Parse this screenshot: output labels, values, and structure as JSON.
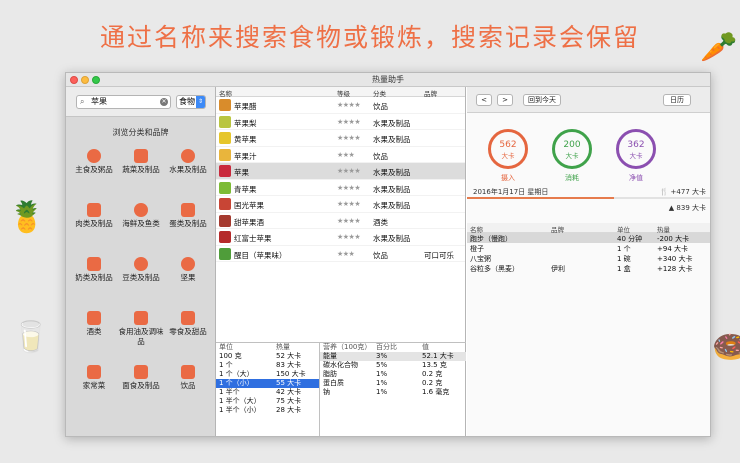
{
  "promo": {
    "headline": "通过名称来搜索食物或锻炼，搜索记录会保留"
  },
  "window": {
    "title": "热量助手"
  },
  "search": {
    "value": "苹果",
    "category": "食物"
  },
  "browse": {
    "title": "浏览分类和品牌"
  },
  "categories": [
    {
      "label": "主食及粥品",
      "icon": "bowl-icon"
    },
    {
      "label": "蔬菜及制品",
      "icon": "carrot-icon"
    },
    {
      "label": "水果及制品",
      "icon": "strawberry-icon"
    },
    {
      "label": "肉类及制品",
      "icon": "meat-icon"
    },
    {
      "label": "海鲜及鱼类",
      "icon": "fish-icon"
    },
    {
      "label": "蛋类及制品",
      "icon": "egg-icon"
    },
    {
      "label": "奶类及制品",
      "icon": "milk-icon"
    },
    {
      "label": "豆类及制品",
      "icon": "bean-icon"
    },
    {
      "label": "坚果",
      "icon": "nut-icon"
    },
    {
      "label": "酒类",
      "icon": "beer-icon"
    },
    {
      "label": "食用油及调味品",
      "icon": "sauce-icon"
    },
    {
      "label": "零食及甜品",
      "icon": "snack-icon"
    },
    {
      "label": "家常菜",
      "icon": "pot-icon"
    },
    {
      "label": "面食及制品",
      "icon": "noodle-icon"
    },
    {
      "label": "饮品",
      "icon": "drink-icon"
    }
  ],
  "food_table": {
    "headers": {
      "name": "名称",
      "level": "等级",
      "category": "分类",
      "brand": "品牌"
    },
    "rows": [
      {
        "name": "苹果醋",
        "stars": "★★★★",
        "category": "饮品",
        "brand": "",
        "color": "#d98c2b"
      },
      {
        "name": "苹果梨",
        "stars": "★★★★",
        "category": "水果及制品",
        "brand": "",
        "color": "#b9c540"
      },
      {
        "name": "黄苹果",
        "stars": "★★★★",
        "category": "水果及制品",
        "brand": "",
        "color": "#e6c62b"
      },
      {
        "name": "苹果汁",
        "stars": "★★★",
        "category": "饮品",
        "brand": "",
        "color": "#e9b53c"
      },
      {
        "name": "苹果",
        "stars": "★★★★",
        "category": "水果及制品",
        "brand": "",
        "color": "#c9293c"
      },
      {
        "name": "青苹果",
        "stars": "★★★★",
        "category": "水果及制品",
        "brand": "",
        "color": "#7dbb35"
      },
      {
        "name": "国光苹果",
        "stars": "★★★★",
        "category": "水果及制品",
        "brand": "",
        "color": "#c84535"
      },
      {
        "name": "甜苹果酒",
        "stars": "★★★★",
        "category": "酒类",
        "brand": "",
        "color": "#a53a2f"
      },
      {
        "name": "红富士苹果",
        "stars": "★★★★",
        "category": "水果及制品",
        "brand": "",
        "color": "#b52a2a"
      },
      {
        "name": "醒目（苹果味）",
        "stars": "★★★",
        "category": "饮品",
        "brand": "可口可乐",
        "color": "#4f9d3a"
      }
    ]
  },
  "units_table": {
    "headers": {
      "unit": "单位",
      "kcal": "热量"
    },
    "rows": [
      {
        "unit": "100 克",
        "kcal": "52 大卡"
      },
      {
        "unit": "1 个",
        "kcal": "83 大卡"
      },
      {
        "unit": "1 个（大）",
        "kcal": "150 大卡"
      },
      {
        "unit": "1 个（小）",
        "kcal": "55 大卡"
      },
      {
        "unit": "1 半个",
        "kcal": "42 大卡"
      },
      {
        "unit": "1 半个（大）",
        "kcal": "75 大卡"
      },
      {
        "unit": "1 半个（小）",
        "kcal": "28 大卡"
      }
    ]
  },
  "nutrition_table": {
    "headers": {
      "nutrient": "营养（100克）",
      "percent": "百分比",
      "value": "值"
    },
    "rows": [
      {
        "nutrient": "能量",
        "percent": "3%",
        "value": "52.1 大卡"
      },
      {
        "nutrient": "碳水化合物",
        "percent": "5%",
        "value": "13.5 克"
      },
      {
        "nutrient": "脂肪",
        "percent": "1%",
        "value": "0.2 克"
      },
      {
        "nutrient": "蛋白质",
        "percent": "1%",
        "value": "0.2 克"
      },
      {
        "nutrient": "钠",
        "percent": "1%",
        "value": "1.6 毫克"
      }
    ]
  },
  "day_panel": {
    "prev": "<",
    "next": ">",
    "today": "回到今天",
    "calendar": "日历",
    "rings": [
      {
        "value": "562",
        "unit": "大卡",
        "label": "摄入",
        "color": "#e5663f"
      },
      {
        "value": "200",
        "unit": "大卡",
        "label": "消耗",
        "color": "#3fa24a"
      },
      {
        "value": "362",
        "unit": "大卡",
        "label": "净值",
        "color": "#8b4fb0"
      }
    ],
    "date": "2016年1月17日 星期日",
    "intake": "+477 大卡",
    "burn": "839 大卡",
    "progress": 0.6
  },
  "log_table": {
    "headers": {
      "name": "名称",
      "brand": "品牌",
      "unit": "单位",
      "kcal": "热量"
    },
    "rows": [
      {
        "name": "跑步（慢跑）",
        "brand": "",
        "unit": "40 分钟",
        "kcal": "-200 大卡"
      },
      {
        "name": "橙子",
        "brand": "",
        "unit": "1 个",
        "kcal": "+94 大卡"
      },
      {
        "name": "八宝粥",
        "brand": "",
        "unit": "1 碗",
        "kcal": "+340 大卡"
      },
      {
        "name": "谷粒多（黑麦）",
        "brand": "伊利",
        "unit": "1 盒",
        "kcal": "+128 大卡"
      }
    ]
  }
}
